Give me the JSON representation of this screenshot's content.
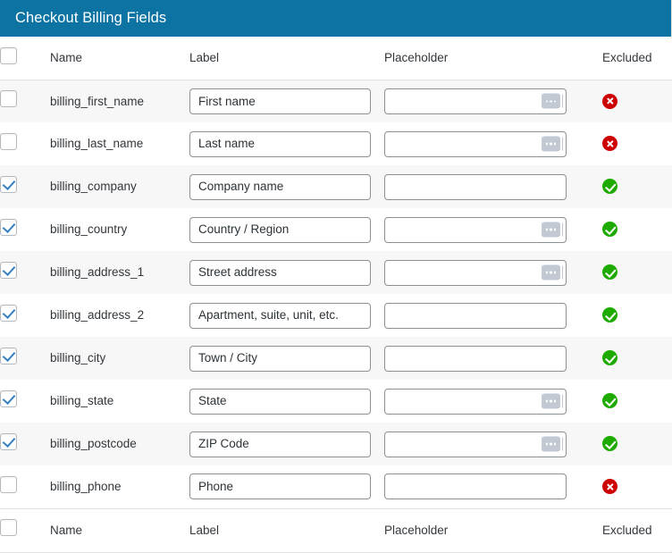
{
  "header": {
    "title": "Checkout Billing Fields",
    "accent_color": "#0c73a3",
    "title_color": "#ffffff"
  },
  "table": {
    "columns": {
      "select_all": "",
      "name": "Name",
      "label": "Label",
      "placeholder": "Placeholder",
      "excluded": "Excluded"
    },
    "select_all_checked": false,
    "footer_columns": {
      "select_all": "",
      "name": "Name",
      "label": "Label",
      "placeholder": "Placeholder",
      "excluded": "Excluded"
    },
    "footer_select_all_checked": false,
    "status_colors": {
      "excluded": "#cc0000",
      "included": "#1faa00"
    },
    "rows": [
      {
        "checked": false,
        "name": "billing_first_name",
        "label_value": "First name",
        "placeholder_value": "",
        "placeholder_has_badge": true,
        "excluded_icon": "error-circle-icon",
        "excluded_state": "excluded"
      },
      {
        "checked": false,
        "name": "billing_last_name",
        "label_value": "Last name",
        "placeholder_value": "",
        "placeholder_has_badge": true,
        "excluded_icon": "error-circle-icon",
        "excluded_state": "excluded"
      },
      {
        "checked": true,
        "name": "billing_company",
        "label_value": "Company name",
        "placeholder_value": "",
        "placeholder_has_badge": false,
        "excluded_icon": "check-circle-icon",
        "excluded_state": "included"
      },
      {
        "checked": true,
        "name": "billing_country",
        "label_value": "Country / Region",
        "placeholder_value": "",
        "placeholder_has_badge": true,
        "excluded_icon": "check-circle-icon",
        "excluded_state": "included"
      },
      {
        "checked": true,
        "name": "billing_address_1",
        "label_value": "Street address",
        "placeholder_value": "",
        "placeholder_has_badge": true,
        "excluded_icon": "check-circle-icon",
        "excluded_state": "included"
      },
      {
        "checked": true,
        "name": "billing_address_2",
        "label_value": "Apartment, suite, unit, etc.",
        "placeholder_value": "",
        "placeholder_has_badge": false,
        "excluded_icon": "check-circle-icon",
        "excluded_state": "included"
      },
      {
        "checked": true,
        "name": "billing_city",
        "label_value": "Town / City",
        "placeholder_value": "",
        "placeholder_has_badge": false,
        "excluded_icon": "check-circle-icon",
        "excluded_state": "included"
      },
      {
        "checked": true,
        "name": "billing_state",
        "label_value": "State",
        "placeholder_value": "",
        "placeholder_has_badge": true,
        "excluded_icon": "check-circle-icon",
        "excluded_state": "included"
      },
      {
        "checked": true,
        "name": "billing_postcode",
        "label_value": "ZIP Code",
        "placeholder_value": "",
        "placeholder_has_badge": true,
        "excluded_icon": "check-circle-icon",
        "excluded_state": "included"
      },
      {
        "checked": false,
        "name": "billing_phone",
        "label_value": "Phone",
        "placeholder_value": "",
        "placeholder_has_badge": false,
        "excluded_icon": "error-circle-icon",
        "excluded_state": "excluded"
      }
    ]
  }
}
